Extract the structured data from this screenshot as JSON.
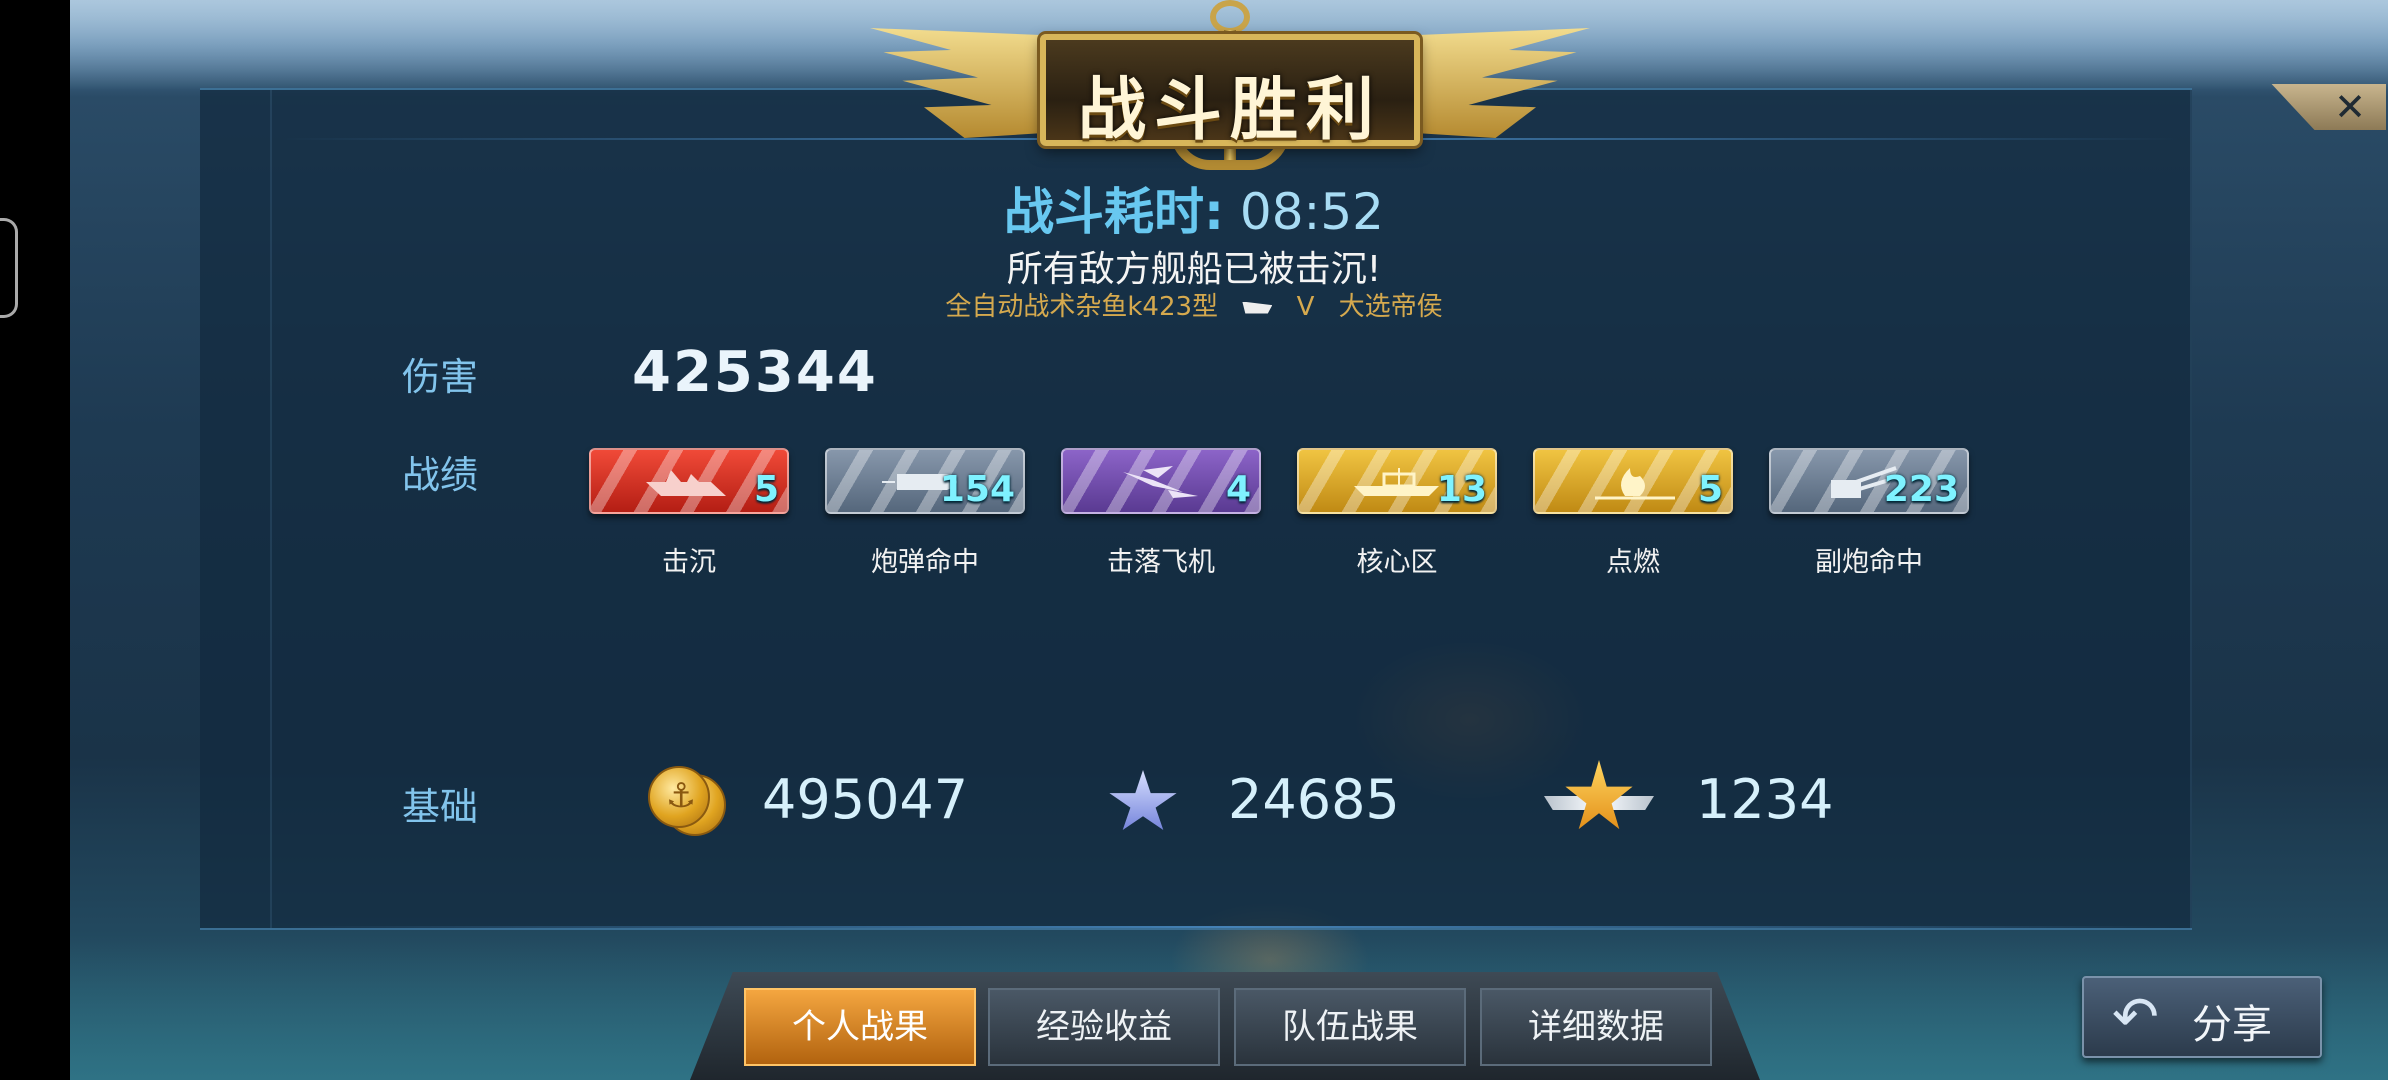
{
  "emblem": {
    "title": "战斗胜利"
  },
  "header": {
    "battle_time_label": "战斗耗时:",
    "battle_time_value": "08:52",
    "result_message": "所有敌方舰船已被击沉!",
    "ship_name": "全自动战术杂鱼k423型",
    "tier": "V",
    "rank": "大选帝侯"
  },
  "damage": {
    "label": "伤害",
    "value": "425344"
  },
  "record": {
    "label": "战绩",
    "medals": [
      {
        "label": "击沉",
        "count": "5",
        "color": "red",
        "icon": "sinking-ship-icon"
      },
      {
        "label": "炮弹命中",
        "count": "154",
        "color": "grey",
        "icon": "shell-icon"
      },
      {
        "label": "击落飞机",
        "count": "4",
        "color": "purple",
        "icon": "falling-plane-icon"
      },
      {
        "label": "核心区",
        "count": "13",
        "color": "gold",
        "icon": "citadel-ship-icon"
      },
      {
        "label": "点燃",
        "count": "5",
        "color": "gold",
        "icon": "fire-icon"
      },
      {
        "label": "副炮命中",
        "count": "223",
        "color": "grey",
        "icon": "secondary-gun-icon"
      }
    ]
  },
  "basics": {
    "label": "基础",
    "credits": "495047",
    "free_exp": "24685",
    "captain_exp": "1234"
  },
  "tabs": [
    "个人战果",
    "经验收益",
    "队伍战果",
    "详细数据"
  ],
  "share": {
    "label": "分享"
  },
  "close": {
    "icon": "close-icon"
  }
}
